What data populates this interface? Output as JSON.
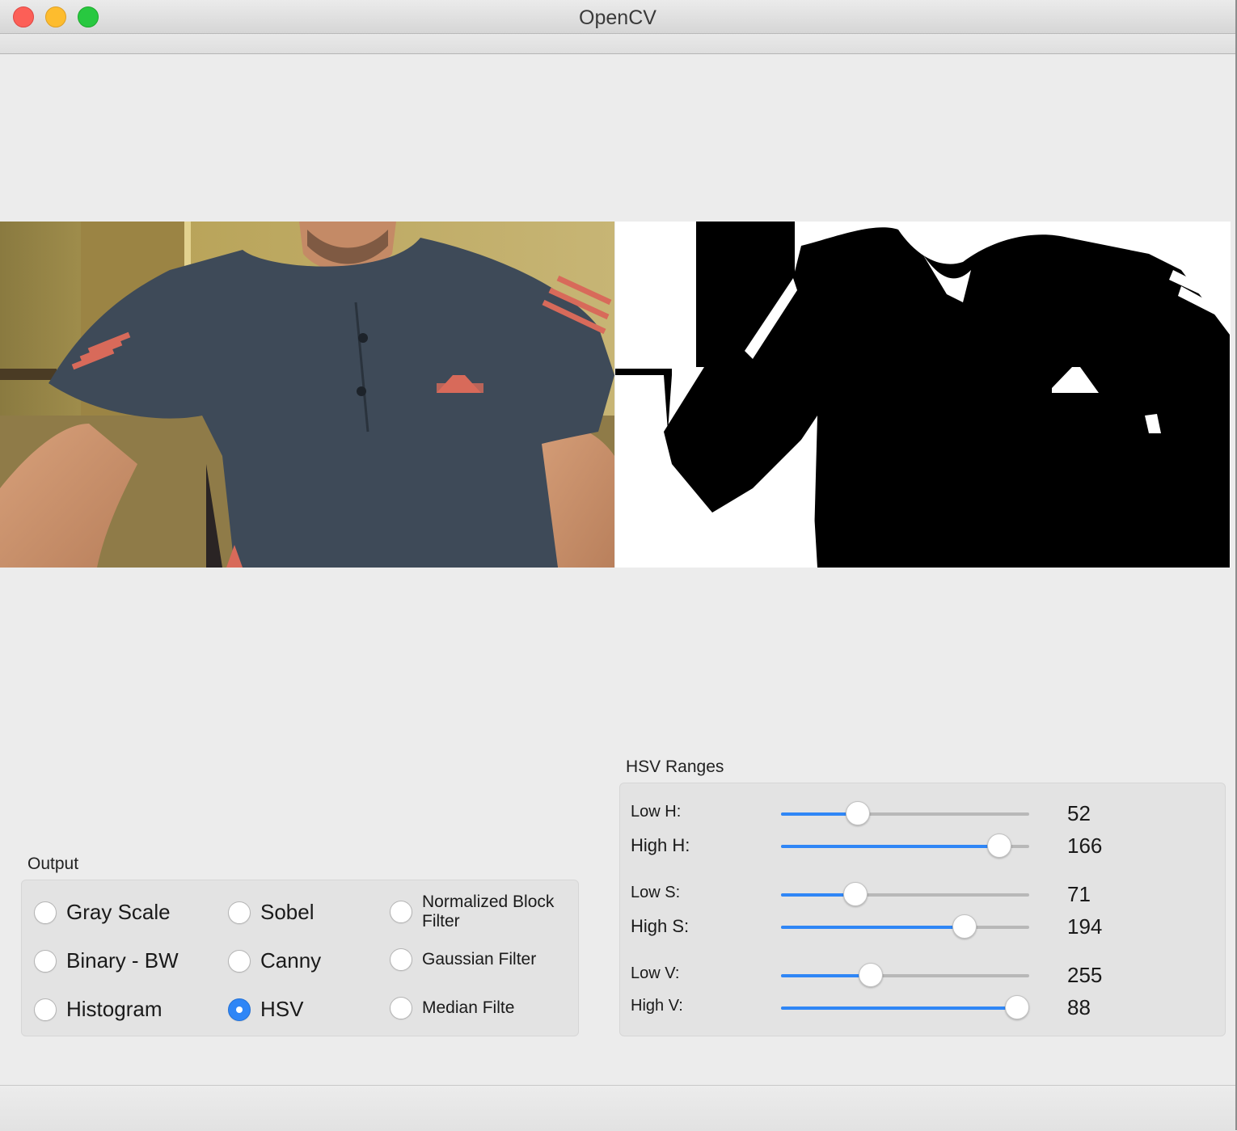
{
  "window": {
    "title": "OpenCV"
  },
  "output": {
    "label": "Output",
    "options": [
      {
        "label": "Gray Scale",
        "checked": false
      },
      {
        "label": "Sobel",
        "checked": false
      },
      {
        "label": "Normalized Block Filter",
        "checked": false
      },
      {
        "label": "Binary - BW",
        "checked": false
      },
      {
        "label": "Canny",
        "checked": false
      },
      {
        "label": "Gaussian Filter",
        "checked": false
      },
      {
        "label": "Histogram",
        "checked": false
      },
      {
        "label": "HSV",
        "checked": true
      },
      {
        "label": "Median Filte",
        "checked": false
      }
    ]
  },
  "hsv": {
    "label": "HSV Ranges",
    "max": 255,
    "sliders": [
      {
        "name": "Low H:",
        "value": "52",
        "fraction": 0.31
      },
      {
        "name": "High H:",
        "value": "166",
        "fraction": 0.88
      },
      {
        "name": "Low S:",
        "value": "71",
        "fraction": 0.3
      },
      {
        "name": "High S:",
        "value": "194",
        "fraction": 0.74
      },
      {
        "name": "Low V:",
        "value": "255",
        "fraction": 0.36
      },
      {
        "name": "High V:",
        "value": "88",
        "fraction": 0.95
      }
    ]
  },
  "colors": {
    "accent": "#2f86f6",
    "shirt": "#3e4a58",
    "stripe": "#d86a5a",
    "wall": "#b29a52"
  }
}
